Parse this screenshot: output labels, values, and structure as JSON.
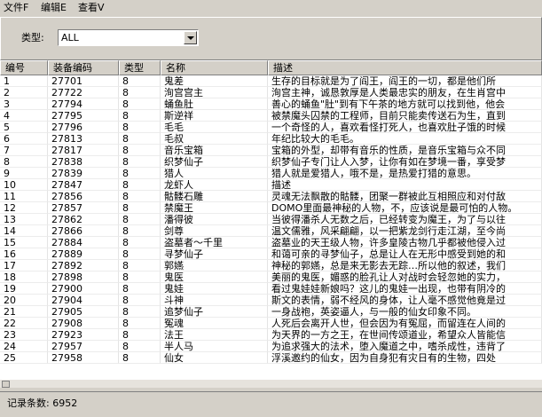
{
  "menu": [
    "文件F",
    "编辑E",
    "查看V"
  ],
  "filter": {
    "label": "类型:",
    "value": "ALL"
  },
  "columns": [
    "编号",
    "装备编码",
    "类型",
    "名称",
    "描述"
  ],
  "rows": [
    [
      "1",
      "27701",
      "8",
      "鬼差",
      "生存的目标就是为了阎王，阎王的一切，都是他们所"
    ],
    [
      "2",
      "27722",
      "8",
      "洵宫宫主",
      "洵宫主神，诚恳敦厚是人类最忠实的朋友，在生肖宫中"
    ],
    [
      "3",
      "27794",
      "8",
      "蛹鱼肚",
      "善心的蛹鱼\"肚\"到有下午茶的地方就可以找到他，他会"
    ],
    [
      "4",
      "27795",
      "8",
      "斯逆祥",
      "被禁魔头囚禁的工程师，目前只能卖传送石为生，直到"
    ],
    [
      "5",
      "27796",
      "8",
      "毛毛",
      "一个奇怪的人，喜欢看怪打死人，也喜欢肚子饿的时候"
    ],
    [
      "6",
      "27813",
      "8",
      "毛叔",
      "年纪比较大的毛毛。"
    ],
    [
      "7",
      "27817",
      "8",
      "音乐宝箱",
      "宝箱的外型，却带有音乐的性质，是音乐宝箱与众不同"
    ],
    [
      "8",
      "27838",
      "8",
      "织梦仙子",
      "织梦仙子专门让人入梦，让你有如在梦境一番，享受梦"
    ],
    [
      "9",
      "27839",
      "8",
      "猎人",
      "猎人就是爱猎人，哦不是，是热爱打猎的意思。"
    ],
    [
      "10",
      "27847",
      "8",
      "龙虾人",
      "描述"
    ],
    [
      "11",
      "27856",
      "8",
      "骷髅石雕",
      "灵魂无法飘散的骷髅，团聚一群被此互相照应和对付敌"
    ],
    [
      "12",
      "27857",
      "8",
      "禁魔王",
      "DOMO里面最神秘的人物，不，应该说是最可怕的人物。"
    ],
    [
      "13",
      "27862",
      "8",
      "潘得彼",
      "当彼得潘杀人无数之后，已经转变为魔王，为了与以往"
    ],
    [
      "14",
      "27866",
      "8",
      "剑尊",
      "温文儒雅，风采翩翩，以一把紫龙剑行走江湖，至今尚"
    ],
    [
      "15",
      "27884",
      "8",
      "盗墓者～千里",
      "盗墓业的天王级人物，许多皇陵古物几乎都被他侵入过"
    ],
    [
      "16",
      "27889",
      "8",
      "寻梦仙子",
      "和蔼可亲的寻梦仙子，总是让人在无形中感受到她的和"
    ],
    [
      "17",
      "27892",
      "8",
      "郭嬿",
      "神秘的郭嬿，总是来无影去无踪…所以他的叙述，我们"
    ],
    [
      "18",
      "27898",
      "8",
      "鬼医",
      "美丽的鬼医，媚惑的脸孔让人对战时会轻忽她的实力，"
    ],
    [
      "19",
      "27900",
      "8",
      "鬼娃",
      "看过鬼娃娃新娘吗？这儿的鬼娃一出现，也带有阴冷的"
    ],
    [
      "20",
      "27904",
      "8",
      "斗神",
      "斯文的表情，弱不经风的身体，让人毫不感觉他竟是过"
    ],
    [
      "21",
      "27905",
      "8",
      "追梦仙子",
      "一身战袍，英姿逼人，与一般的仙女印象不同。"
    ],
    [
      "22",
      "27908",
      "8",
      "冤魂",
      "人死后会离开人世，但会因为有冤屈，而留连在人间的"
    ],
    [
      "23",
      "27923",
      "8",
      "法王",
      "为天界的一方之王，在世间传颂道业，希望众人皆能信"
    ],
    [
      "24",
      "27957",
      "8",
      "半人马",
      "为追求强大的法术，堕入魔道之中，嗜杀成性，违背了"
    ],
    [
      "25",
      "27958",
      "8",
      "仙女",
      "浮溪邀约的仙女，因为自身犯有灾日有的生物，四处"
    ]
  ],
  "status": {
    "label": "记录条数:",
    "count": "6952"
  }
}
